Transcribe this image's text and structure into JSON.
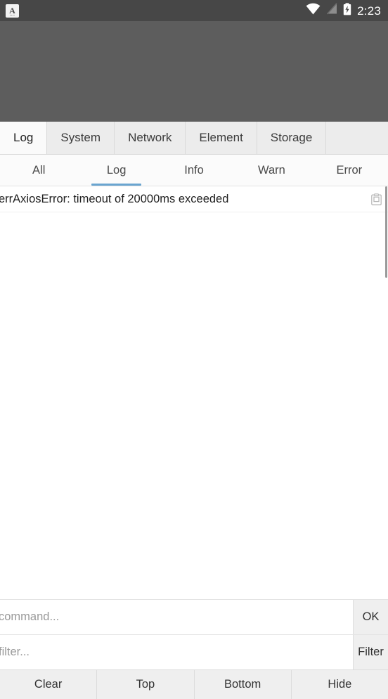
{
  "statusbar": {
    "notification_icon": "app-letter-icon",
    "notification_letter": "A",
    "notification_dots": "....",
    "wifi_icon": "wifi-icon",
    "signal_icon": "no-sim-signal-icon",
    "battery_icon": "battery-charging-icon",
    "time": "2:23"
  },
  "console": {
    "tabs": [
      {
        "label": "Log",
        "active": true
      },
      {
        "label": "System",
        "active": false
      },
      {
        "label": "Network",
        "active": false
      },
      {
        "label": "Element",
        "active": false
      },
      {
        "label": "Storage",
        "active": false
      }
    ],
    "subtabs": [
      {
        "label": "All",
        "active": false
      },
      {
        "label": "Log",
        "active": true
      },
      {
        "label": "Info",
        "active": false
      },
      {
        "label": "Warn",
        "active": false
      },
      {
        "label": "Error",
        "active": false
      }
    ],
    "accent_color": "#6aa5d0",
    "logs": [
      {
        "text": "errAxiosError: timeout of 20000ms exceeded",
        "copy_icon": "clipboard-icon"
      }
    ],
    "command": {
      "value": "",
      "placeholder": "command...",
      "button_label": "OK"
    },
    "filter": {
      "value": "",
      "placeholder": "filter...",
      "button_label": "Filter"
    },
    "toolbar": [
      {
        "label": "Clear"
      },
      {
        "label": "Top"
      },
      {
        "label": "Bottom"
      },
      {
        "label": "Hide"
      }
    ]
  }
}
